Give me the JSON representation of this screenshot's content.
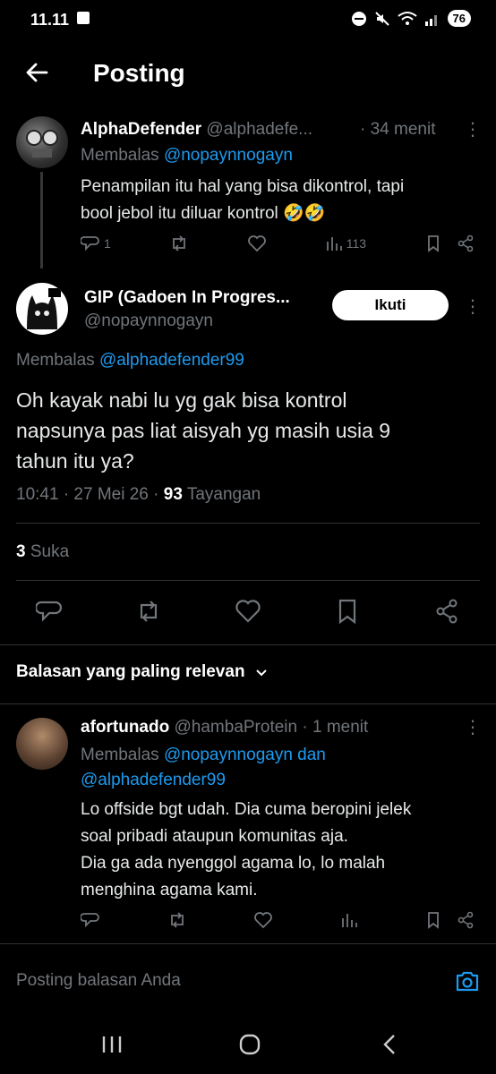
{
  "status_bar": {
    "time": "11.11",
    "battery": "76"
  },
  "header": {
    "title": "Posting"
  },
  "parent_post": {
    "display_name": "AlphaDefender",
    "handle": "@alphadefe...",
    "time": "· 34 menit",
    "reply_prefix": "Membalas",
    "reply_to": "@nopaynnogayn",
    "text_line1": "Penampilan itu hal yang bisa dikontrol, tapi",
    "text_line2": "bool jebol itu diluar kontrol 🤣🤣",
    "reply_count": "1",
    "view_count": "113"
  },
  "main_post": {
    "display_name": "GIP (Gadoen In Progres...",
    "handle": "@nopaynnogayn",
    "follow_label": "Ikuti",
    "reply_prefix": "Membalas",
    "reply_to": "@alphadefender99",
    "text_line1": "Oh kayak nabi lu yg gak bisa kontrol",
    "text_line2": "napsunya pas liat aisyah yg masih usia 9",
    "text_line3": "tahun itu ya?",
    "time": "10:41 · 27 Mei 26 ·",
    "views": "93",
    "views_label": "Tayangan",
    "likes": "3",
    "likes_label": "Suka"
  },
  "sort": {
    "label": "Balasan yang paling relevan"
  },
  "reply_post": {
    "display_name": "afortunado",
    "handle": "@hambaProtein",
    "time": "· 1 menit",
    "reply_prefix": "Membalas",
    "reply_to_1": "@nopaynnogayn dan",
    "reply_to_2": "@alphadefender99",
    "text_line1": "Lo offside bgt udah. Dia cuma beropini jelek",
    "text_line2": "soal pribadi ataupun komunitas aja.",
    "text_line3": "Dia ga ada nyenggol agama lo, lo malah",
    "text_line4": "menghina agama kami."
  },
  "composer": {
    "placeholder": "Posting balasan Anda"
  },
  "colors": {
    "accent": "#1d9bf0",
    "background": "#000000",
    "muted": "#71767b"
  }
}
